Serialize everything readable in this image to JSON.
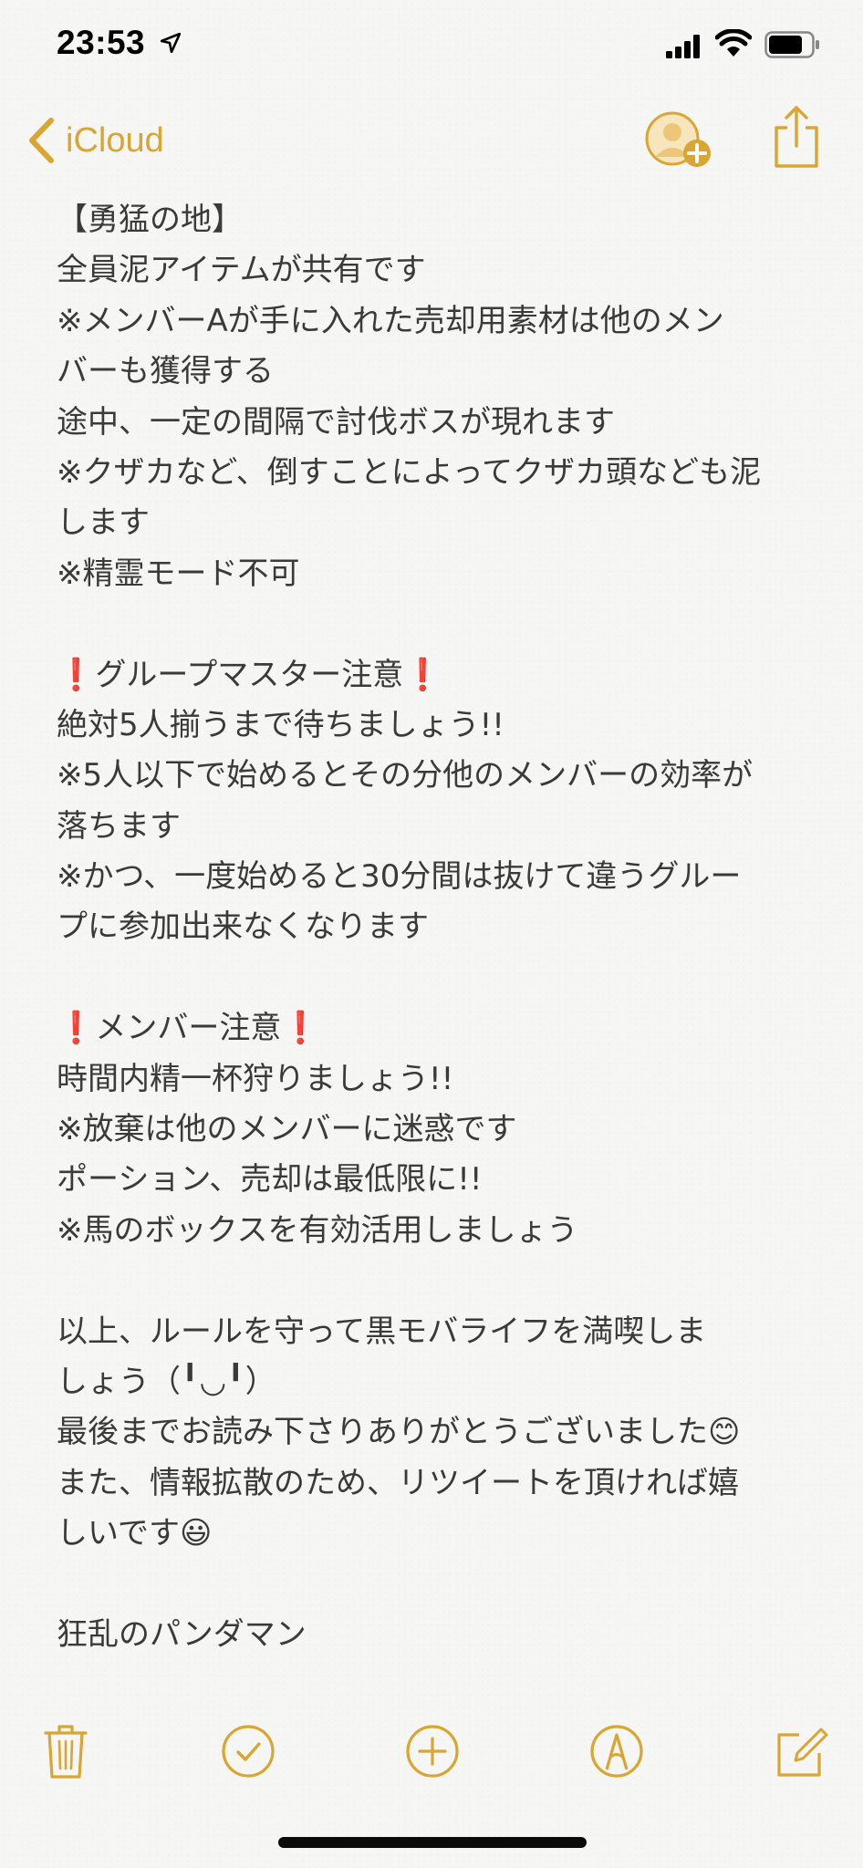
{
  "status_bar": {
    "time": "23:53",
    "icons": [
      "location-arrow-icon",
      "cellular-signal-icon",
      "wifi-icon",
      "battery-icon"
    ]
  },
  "navbar": {
    "back_label": "iCloud",
    "accent_color": "#d9a533",
    "icons": [
      "chevron-left-icon",
      "add-person-icon",
      "share-icon"
    ]
  },
  "note": {
    "lines": [
      "【勇猛の地】",
      "全員泥アイテムが共有です",
      "※メンバーAが手に入れた売却用素材は他のメン",
      "バーも獲得する",
      "途中、一定の間隔で討伐ボスが現れます",
      "※クザカなど、倒すことによってクザカ頭なども泥",
      "します",
      "※精霊モード不可",
      "",
      "❗グループマスター注意❗",
      "絶対5人揃うまで待ちましょう!!",
      "※5人以下で始めるとその分他のメンバーの効率が",
      "落ちます",
      "※かつ、一度始めると30分間は抜けて違うグルー",
      "プに参加出来なくなります",
      "",
      "❗メンバー注意❗",
      "時間内精一杯狩りましょう!!",
      "※放棄は他のメンバーに迷惑です",
      "ポーション、売却は最低限に!!",
      "※馬のボックスを有効活用しましょう",
      "",
      "以上、ルールを守って黒モバライフを満喫しま",
      "しょう（╹◡╹）",
      "最後までお読み下さりありがとうございました😊",
      "また、情報拡散のため、リツイートを頂ければ嬉",
      "しいです😃",
      "",
      "狂乱のパンダマン"
    ]
  },
  "toolbar": {
    "icons": [
      "trash-icon",
      "checklist-icon",
      "add-icon",
      "markup-pen-icon",
      "compose-icon"
    ]
  }
}
